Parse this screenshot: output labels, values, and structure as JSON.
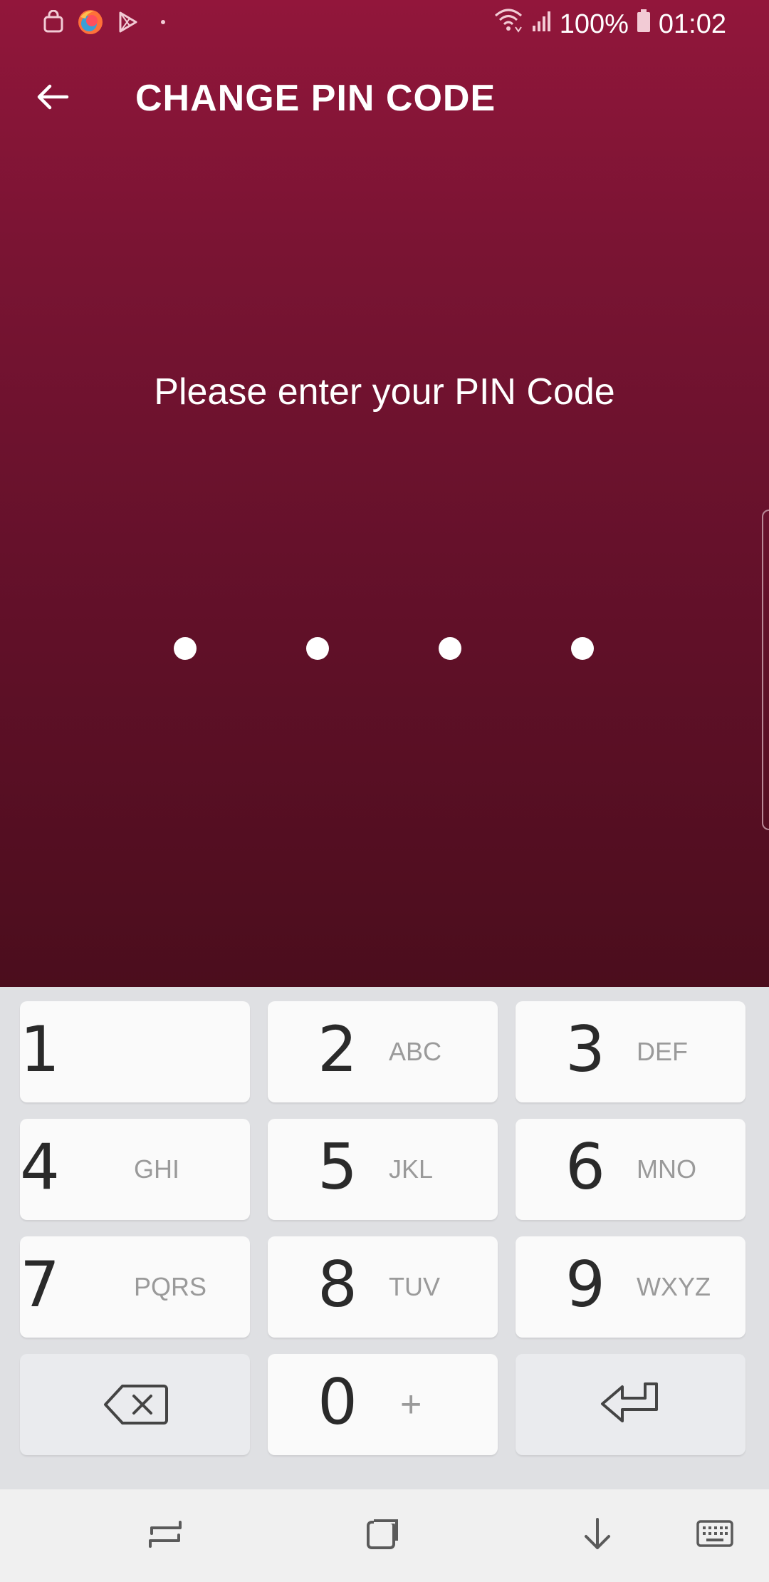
{
  "status_bar": {
    "battery": "100%",
    "time": "01:02",
    "left_icons": [
      "shopping-bag-icon",
      "firefox-icon",
      "play-store-icon",
      "dot-icon"
    ],
    "right_icons": [
      "wifi-icon",
      "signal-icon",
      "battery-icon"
    ]
  },
  "header": {
    "title": "CHANGE PIN CODE",
    "back_icon": "arrow-left-icon"
  },
  "main": {
    "prompt": "Please enter your PIN Code",
    "pin_length": 4,
    "pin_entered": 0
  },
  "keypad": {
    "keys": [
      {
        "digit": "1",
        "letters": ""
      },
      {
        "digit": "2",
        "letters": "ABC"
      },
      {
        "digit": "3",
        "letters": "DEF"
      },
      {
        "digit": "4",
        "letters": "GHI"
      },
      {
        "digit": "5",
        "letters": "JKL"
      },
      {
        "digit": "6",
        "letters": "MNO"
      },
      {
        "digit": "7",
        "letters": "PQRS"
      },
      {
        "digit": "8",
        "letters": "TUV"
      },
      {
        "digit": "9",
        "letters": "WXYZ"
      }
    ],
    "zero": {
      "digit": "0",
      "extra": "+"
    },
    "backspace_icon": "backspace-icon",
    "enter_icon": "enter-icon"
  },
  "nav_bar": {
    "icons": [
      "recent-apps-icon",
      "home-icon",
      "hide-keyboard-icon",
      "keyboard-icon"
    ]
  },
  "colors": {
    "header_top": "#92163b",
    "header_bottom": "#4b0d1d",
    "keypad_bg": "#dfe0e3",
    "key_bg": "#fafafa"
  }
}
